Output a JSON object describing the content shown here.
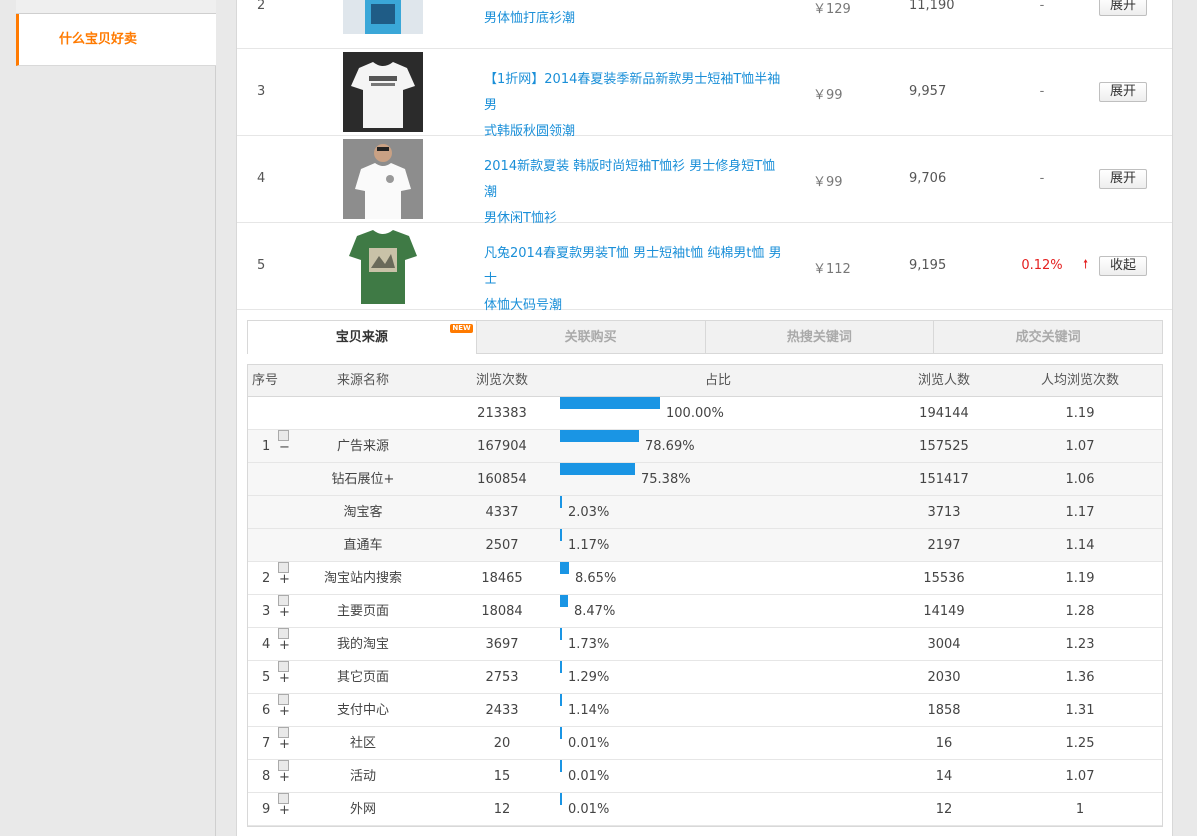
{
  "sidebar": {
    "active_item": "什么宝贝好卖"
  },
  "products": [
    {
      "rank": "2",
      "title_line2": "男体恤打底衫潮",
      "price": "￥129",
      "sales": "11,190",
      "trend": "-",
      "action": "展开"
    },
    {
      "rank": "3",
      "title_line1": "【1折网】2014春夏装季新品新款男士短袖T恤半袖男",
      "title_line2": "式韩版秋圆领潮",
      "price": "￥99",
      "sales": "9,957",
      "trend": "-",
      "action": "展开"
    },
    {
      "rank": "4",
      "title_line1": "2014新款夏装 韩版时尚短袖T恤衫 男士修身短T恤 潮",
      "title_line2": "男休闲T恤衫",
      "price": "￥99",
      "sales": "9,706",
      "trend": "-",
      "action": "展开"
    },
    {
      "rank": "5",
      "title_line1": "凡兔2014春夏款男装T恤 男士短袖t恤 纯棉男t恤 男士",
      "title_line2": "体恤大码号潮",
      "price": "￥112",
      "sales": "9,195",
      "trend": "0.12%",
      "action": "收起"
    }
  ],
  "tabs": [
    "宝贝来源",
    "关联购买",
    "热搜关键词",
    "成交关键词"
  ],
  "new_badge": "NEW",
  "table": {
    "headers": {
      "idx": "序号",
      "name": "来源名称",
      "pv": "浏览次数",
      "ratio": "占比",
      "uv": "浏览人数",
      "avg": "人均浏览次数"
    },
    "rows": [
      {
        "idx": "",
        "name": "",
        "pv": "213383",
        "ratio": 100.0,
        "ratio_text": "100.00%",
        "uv": "194144",
        "avg": "1.19",
        "toggle": ""
      },
      {
        "idx": "1",
        "name": "广告来源",
        "pv": "167904",
        "ratio": 78.69,
        "ratio_text": "78.69%",
        "uv": "157525",
        "avg": "1.07",
        "toggle": "−"
      },
      {
        "idx": "",
        "name": "钻石展位+",
        "pv": "160854",
        "ratio": 75.38,
        "ratio_text": "75.38%",
        "uv": "151417",
        "avg": "1.06",
        "toggle": ""
      },
      {
        "idx": "",
        "name": "淘宝客",
        "pv": "4337",
        "ratio": 2.03,
        "ratio_text": "2.03%",
        "uv": "3713",
        "avg": "1.17",
        "toggle": ""
      },
      {
        "idx": "",
        "name": "直通车",
        "pv": "2507",
        "ratio": 1.17,
        "ratio_text": "1.17%",
        "uv": "2197",
        "avg": "1.14",
        "toggle": ""
      },
      {
        "idx": "2",
        "name": "淘宝站内搜索",
        "pv": "18465",
        "ratio": 8.65,
        "ratio_text": "8.65%",
        "uv": "15536",
        "avg": "1.19",
        "toggle": "+"
      },
      {
        "idx": "3",
        "name": "主要页面",
        "pv": "18084",
        "ratio": 8.47,
        "ratio_text": "8.47%",
        "uv": "14149",
        "avg": "1.28",
        "toggle": "+"
      },
      {
        "idx": "4",
        "name": "我的淘宝",
        "pv": "3697",
        "ratio": 1.73,
        "ratio_text": "1.73%",
        "uv": "3004",
        "avg": "1.23",
        "toggle": "+"
      },
      {
        "idx": "5",
        "name": "其它页面",
        "pv": "2753",
        "ratio": 1.29,
        "ratio_text": "1.29%",
        "uv": "2030",
        "avg": "1.36",
        "toggle": "+"
      },
      {
        "idx": "6",
        "name": "支付中心",
        "pv": "2433",
        "ratio": 1.14,
        "ratio_text": "1.14%",
        "uv": "1858",
        "avg": "1.31",
        "toggle": "+"
      },
      {
        "idx": "7",
        "name": "社区",
        "pv": "20",
        "ratio": 0.01,
        "ratio_text": "0.01%",
        "uv": "16",
        "avg": "1.25",
        "toggle": "+"
      },
      {
        "idx": "8",
        "name": "活动",
        "pv": "15",
        "ratio": 0.01,
        "ratio_text": "0.01%",
        "uv": "14",
        "avg": "1.07",
        "toggle": "+"
      },
      {
        "idx": "9",
        "name": "外网",
        "pv": "12",
        "ratio": 0.01,
        "ratio_text": "0.01%",
        "uv": "12",
        "avg": "1",
        "toggle": "+"
      }
    ]
  },
  "colors": {
    "accent": "#ff7a00",
    "link": "#1a8fd8",
    "bar": "#1a95e4",
    "up": "#e41f1f"
  }
}
